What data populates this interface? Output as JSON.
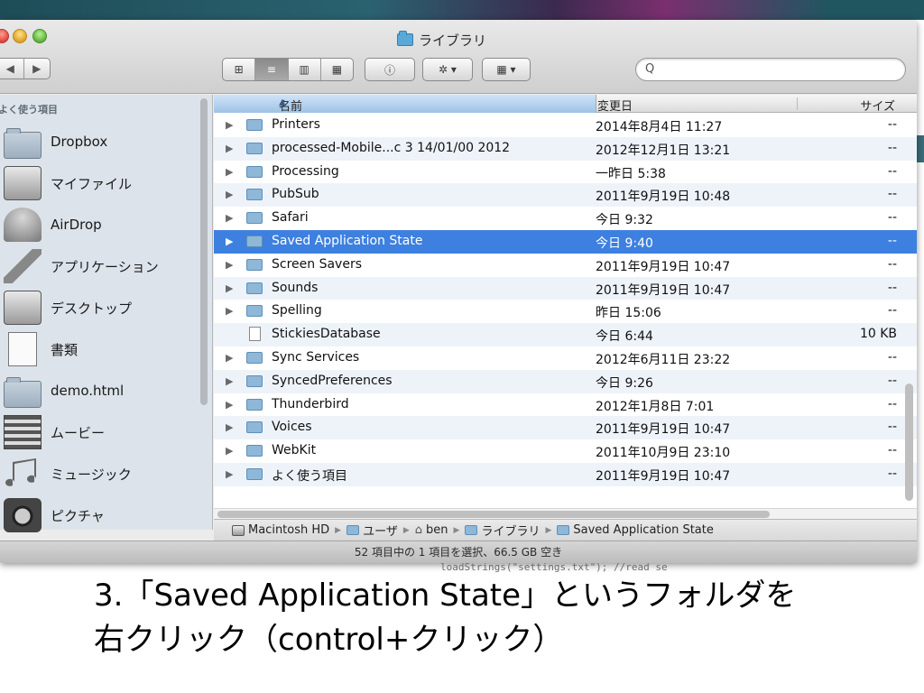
{
  "window": {
    "title": "ライブラリ",
    "search_icon": "Q"
  },
  "toolbar": {
    "nav_back": "◀",
    "nav_forward": "▶",
    "view_icon": "⊞",
    "view_list": "≡",
    "view_column": "▥",
    "view_coverflow": "▦",
    "info_icon": "ⓘ",
    "action_icon": "✲ ▾",
    "arrange_icon": "▦ ▾"
  },
  "sidebar": {
    "heading": "よく使う項目",
    "items": [
      {
        "label": "Dropbox",
        "icon": "folder-icon"
      },
      {
        "label": "マイファイル",
        "icon": "drive-icon"
      },
      {
        "label": "AirDrop",
        "icon": "airdrop-icon"
      },
      {
        "label": "アプリケーション",
        "icon": "applications-icon"
      },
      {
        "label": "デスクトップ",
        "icon": "desktop-icon"
      },
      {
        "label": "書類",
        "icon": "documents-icon"
      },
      {
        "label": "demo.html",
        "icon": "folder-icon"
      },
      {
        "label": "ムービー",
        "icon": "movies-icon"
      },
      {
        "label": "ミュージック",
        "icon": "music-icon"
      },
      {
        "label": "ピクチャ",
        "icon": "camera-icon"
      }
    ]
  },
  "columns": {
    "name": "名前",
    "sort_indicator": "▲",
    "date": "変更日",
    "size": "サイズ"
  },
  "rows": [
    {
      "name": "Printers",
      "date": "2014年8月4日 11:27",
      "size": "--",
      "type": "folder"
    },
    {
      "name": "processed-Mobile...c  3 14/01/00 2012",
      "date": "2012年12月1日 13:21",
      "size": "--",
      "type": "folder"
    },
    {
      "name": "Processing",
      "date": "一昨日 5:38",
      "size": "--",
      "type": "folder"
    },
    {
      "name": "PubSub",
      "date": "2011年9月19日 10:48",
      "size": "--",
      "type": "folder"
    },
    {
      "name": "Safari",
      "date": "今日 9:32",
      "size": "--",
      "type": "folder"
    },
    {
      "name": "Saved Application State",
      "date": "今日 9:40",
      "size": "--",
      "type": "folder",
      "selected": true
    },
    {
      "name": "Screen Savers",
      "date": "2011年9月19日 10:47",
      "size": "--",
      "type": "folder"
    },
    {
      "name": "Sounds",
      "date": "2011年9月19日 10:47",
      "size": "--",
      "type": "folder"
    },
    {
      "name": "Spelling",
      "date": "昨日 15:06",
      "size": "--",
      "type": "folder"
    },
    {
      "name": "StickiesDatabase",
      "date": "今日 6:44",
      "size": "10 KB",
      "type": "file"
    },
    {
      "name": "Sync Services",
      "date": "2012年6月11日 23:22",
      "size": "--",
      "type": "folder"
    },
    {
      "name": "SyncedPreferences",
      "date": "今日 9:26",
      "size": "--",
      "type": "folder"
    },
    {
      "name": "Thunderbird",
      "date": "2012年1月8日 7:01",
      "size": "--",
      "type": "folder"
    },
    {
      "name": "Voices",
      "date": "2011年9月19日 10:47",
      "size": "--",
      "type": "folder"
    },
    {
      "name": "WebKit",
      "date": "2011年10月9日 23:10",
      "size": "--",
      "type": "folder"
    },
    {
      "name": "よく使う項目",
      "date": "2011年9月19日 10:47",
      "size": "--",
      "type": "folder"
    }
  ],
  "pathbar": {
    "disk": "Macintosh HD",
    "users": "ユーザ",
    "home": "ben",
    "library": "ライブラリ",
    "current": "Saved Application State",
    "separator": "▶"
  },
  "status": "52 項目中の 1 項目を選択、66.5 GB 空き",
  "caption": {
    "line1": "3.「Saved Application State」というフォルダを",
    "line2": "右クリック（control+クリック）"
  },
  "code_peek": "loadStrings(\"settings.txt\");   //read se"
}
